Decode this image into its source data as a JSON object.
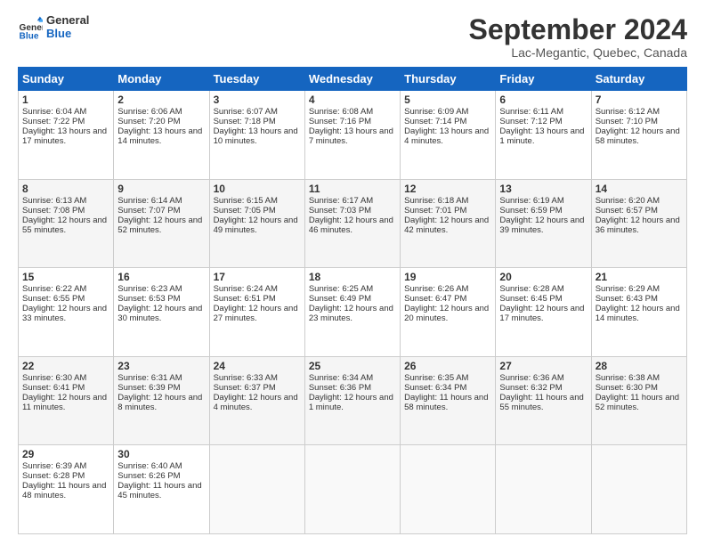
{
  "logo": {
    "line1": "General",
    "line2": "Blue"
  },
  "title": "September 2024",
  "subtitle": "Lac-Megantic, Quebec, Canada",
  "weekdays": [
    "Sunday",
    "Monday",
    "Tuesday",
    "Wednesday",
    "Thursday",
    "Friday",
    "Saturday"
  ],
  "weeks": [
    [
      {
        "day": 1,
        "info": "Sunrise: 6:04 AM\nSunset: 7:22 PM\nDaylight: 13 hours and 17 minutes."
      },
      {
        "day": 2,
        "info": "Sunrise: 6:06 AM\nSunset: 7:20 PM\nDaylight: 13 hours and 14 minutes."
      },
      {
        "day": 3,
        "info": "Sunrise: 6:07 AM\nSunset: 7:18 PM\nDaylight: 13 hours and 10 minutes."
      },
      {
        "day": 4,
        "info": "Sunrise: 6:08 AM\nSunset: 7:16 PM\nDaylight: 13 hours and 7 minutes."
      },
      {
        "day": 5,
        "info": "Sunrise: 6:09 AM\nSunset: 7:14 PM\nDaylight: 13 hours and 4 minutes."
      },
      {
        "day": 6,
        "info": "Sunrise: 6:11 AM\nSunset: 7:12 PM\nDaylight: 13 hours and 1 minute."
      },
      {
        "day": 7,
        "info": "Sunrise: 6:12 AM\nSunset: 7:10 PM\nDaylight: 12 hours and 58 minutes."
      }
    ],
    [
      {
        "day": 8,
        "info": "Sunrise: 6:13 AM\nSunset: 7:08 PM\nDaylight: 12 hours and 55 minutes."
      },
      {
        "day": 9,
        "info": "Sunrise: 6:14 AM\nSunset: 7:07 PM\nDaylight: 12 hours and 52 minutes."
      },
      {
        "day": 10,
        "info": "Sunrise: 6:15 AM\nSunset: 7:05 PM\nDaylight: 12 hours and 49 minutes."
      },
      {
        "day": 11,
        "info": "Sunrise: 6:17 AM\nSunset: 7:03 PM\nDaylight: 12 hours and 46 minutes."
      },
      {
        "day": 12,
        "info": "Sunrise: 6:18 AM\nSunset: 7:01 PM\nDaylight: 12 hours and 42 minutes."
      },
      {
        "day": 13,
        "info": "Sunrise: 6:19 AM\nSunset: 6:59 PM\nDaylight: 12 hours and 39 minutes."
      },
      {
        "day": 14,
        "info": "Sunrise: 6:20 AM\nSunset: 6:57 PM\nDaylight: 12 hours and 36 minutes."
      }
    ],
    [
      {
        "day": 15,
        "info": "Sunrise: 6:22 AM\nSunset: 6:55 PM\nDaylight: 12 hours and 33 minutes."
      },
      {
        "day": 16,
        "info": "Sunrise: 6:23 AM\nSunset: 6:53 PM\nDaylight: 12 hours and 30 minutes."
      },
      {
        "day": 17,
        "info": "Sunrise: 6:24 AM\nSunset: 6:51 PM\nDaylight: 12 hours and 27 minutes."
      },
      {
        "day": 18,
        "info": "Sunrise: 6:25 AM\nSunset: 6:49 PM\nDaylight: 12 hours and 23 minutes."
      },
      {
        "day": 19,
        "info": "Sunrise: 6:26 AM\nSunset: 6:47 PM\nDaylight: 12 hours and 20 minutes."
      },
      {
        "day": 20,
        "info": "Sunrise: 6:28 AM\nSunset: 6:45 PM\nDaylight: 12 hours and 17 minutes."
      },
      {
        "day": 21,
        "info": "Sunrise: 6:29 AM\nSunset: 6:43 PM\nDaylight: 12 hours and 14 minutes."
      }
    ],
    [
      {
        "day": 22,
        "info": "Sunrise: 6:30 AM\nSunset: 6:41 PM\nDaylight: 12 hours and 11 minutes."
      },
      {
        "day": 23,
        "info": "Sunrise: 6:31 AM\nSunset: 6:39 PM\nDaylight: 12 hours and 8 minutes."
      },
      {
        "day": 24,
        "info": "Sunrise: 6:33 AM\nSunset: 6:37 PM\nDaylight: 12 hours and 4 minutes."
      },
      {
        "day": 25,
        "info": "Sunrise: 6:34 AM\nSunset: 6:36 PM\nDaylight: 12 hours and 1 minute."
      },
      {
        "day": 26,
        "info": "Sunrise: 6:35 AM\nSunset: 6:34 PM\nDaylight: 11 hours and 58 minutes."
      },
      {
        "day": 27,
        "info": "Sunrise: 6:36 AM\nSunset: 6:32 PM\nDaylight: 11 hours and 55 minutes."
      },
      {
        "day": 28,
        "info": "Sunrise: 6:38 AM\nSunset: 6:30 PM\nDaylight: 11 hours and 52 minutes."
      }
    ],
    [
      {
        "day": 29,
        "info": "Sunrise: 6:39 AM\nSunset: 6:28 PM\nDaylight: 11 hours and 48 minutes."
      },
      {
        "day": 30,
        "info": "Sunrise: 6:40 AM\nSunset: 6:26 PM\nDaylight: 11 hours and 45 minutes."
      },
      {
        "day": null,
        "info": ""
      },
      {
        "day": null,
        "info": ""
      },
      {
        "day": null,
        "info": ""
      },
      {
        "day": null,
        "info": ""
      },
      {
        "day": null,
        "info": ""
      }
    ]
  ]
}
